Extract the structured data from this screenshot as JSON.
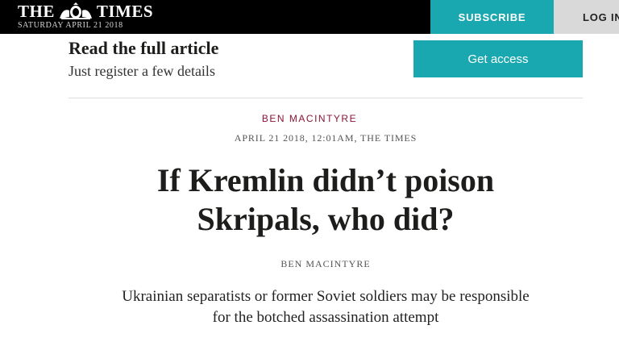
{
  "masthead": {
    "logo_left": "THE",
    "logo_right": "TIMES",
    "date": "SATURDAY APRIL 21 2018",
    "subscribe_label": "SUBSCRIBE",
    "login_label": "LOG IN"
  },
  "paywall": {
    "title": "Read the full article",
    "subtitle": "Just register a few details",
    "button_label": "Get access"
  },
  "article": {
    "kicker": "BEN MACINTYRE",
    "meta": "APRIL 21 2018, 12:01AM, THE TIMES",
    "headline_line1": "If Kremlin didn’t poison",
    "headline_line2": "Skripals, who did?",
    "byline": "BEN MACINTYRE",
    "standfirst_line1": "Ukrainian separatists or former Soviet soldiers may be responsible",
    "standfirst_line2": "for the botched assassination attempt"
  },
  "colors": {
    "accent_teal": "#1aa8b0",
    "kicker_red": "#8a1538",
    "masthead_bg": "#000000"
  },
  "icons": {
    "crest": "royal-coat-of-arms-icon"
  }
}
